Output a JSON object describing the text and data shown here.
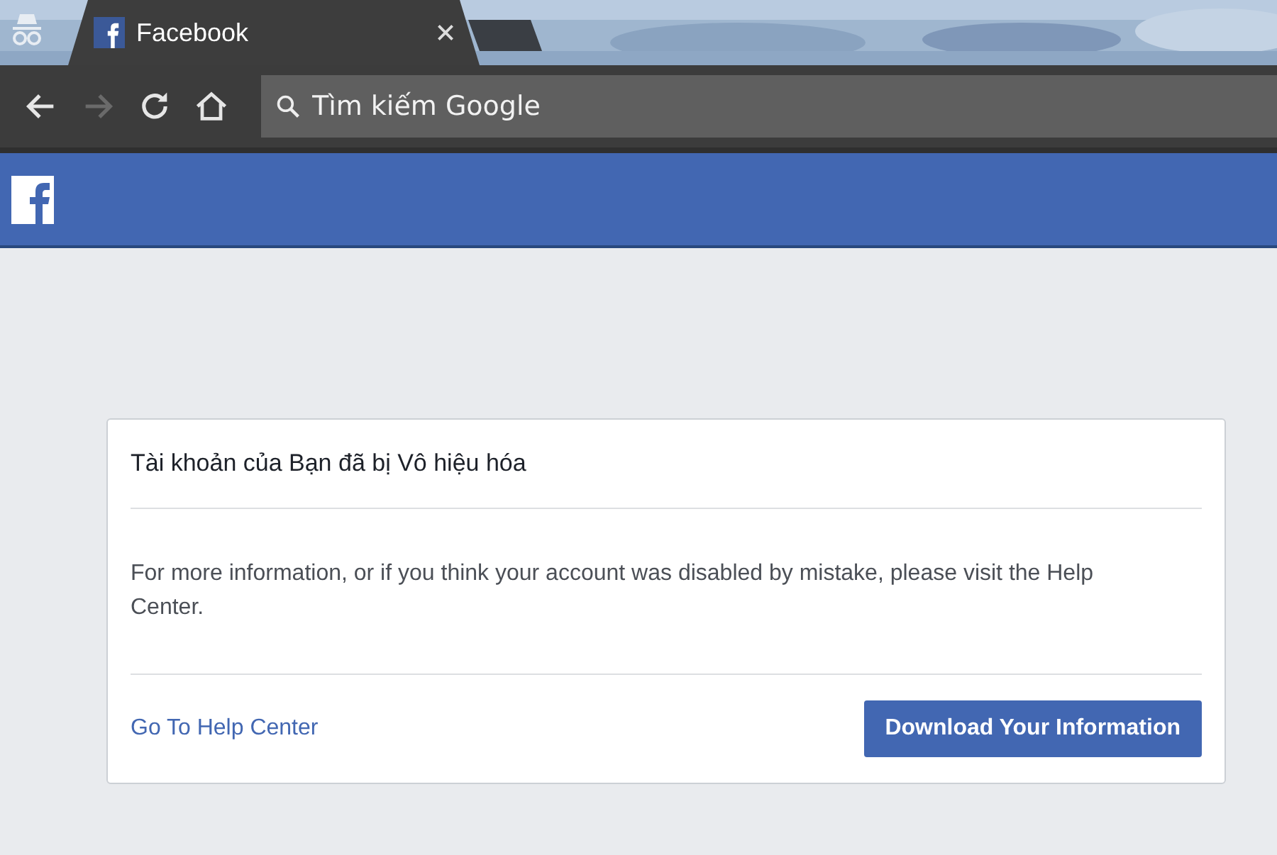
{
  "tabs": [
    {
      "title": "Facebook",
      "selected": true
    }
  ],
  "toolbar": {
    "buttons": [
      {
        "kind": "back",
        "disabled": false
      },
      {
        "kind": "forward",
        "disabled": true
      },
      {
        "kind": "reload",
        "disabled": false
      },
      {
        "kind": "home",
        "disabled": false
      }
    ],
    "address": {
      "placeholder": "Tìm kiếm Google"
    }
  },
  "dialog": {
    "title": "Tài khoản của Bạn đã bị Vô hiệu hóa",
    "message": "For more information, or if you think your account was disabled by mistake, please visit the Help Center.",
    "link": "Go To Help Center",
    "button": "Download Your Information"
  }
}
